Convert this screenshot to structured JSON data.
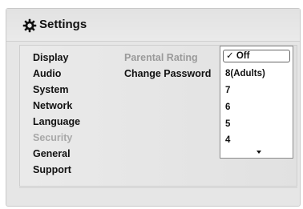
{
  "header": {
    "title": "Settings",
    "icon": "gear-icon"
  },
  "menu": {
    "items": [
      {
        "label": "Display"
      },
      {
        "label": "Audio"
      },
      {
        "label": "System"
      },
      {
        "label": "Network"
      },
      {
        "label": "Language"
      },
      {
        "label": "Security",
        "active": true
      },
      {
        "label": "General"
      },
      {
        "label": "Support"
      }
    ]
  },
  "submenu": {
    "items": [
      {
        "label": "Parental Rating"
      },
      {
        "label": "Change Password"
      }
    ]
  },
  "dropdown": {
    "selected": "Off",
    "check": "✓",
    "options": [
      "Off",
      "8(Adults)",
      "7",
      "6",
      "5",
      "4"
    ]
  },
  "colors": {
    "inactive_text": "#a8a8a8",
    "text": "#111111",
    "panel_bg": "#e6e6e6"
  }
}
